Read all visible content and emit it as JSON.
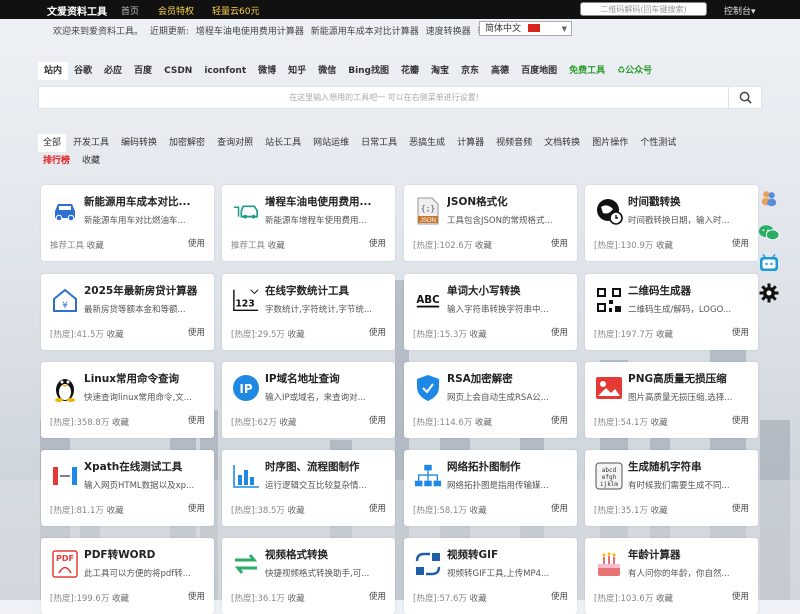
{
  "topbar": {
    "logo": "文爱资料工具",
    "nav": [
      "首页",
      "会员特权",
      "轻量云60元"
    ],
    "search_placeholder": "二维码解码(回车键搜索)",
    "console": "控制台▾"
  },
  "welcome": {
    "greeting": "欢迎来到爱资料工具。",
    "recent_label": "近期更新:",
    "recent": [
      "增程车油电使用费用计算器",
      "新能源用车成本对比计算器",
      "速度转换器",
      "等等"
    ],
    "language": "简体中文"
  },
  "engines": [
    "站内",
    "谷歌",
    "必应",
    "百度",
    "CSDN",
    "iconfont",
    "微博",
    "知乎",
    "微信",
    "Bing找图",
    "花瓣",
    "淘宝",
    "京东",
    "高德",
    "百度地图",
    "免费工具",
    "♻公众号"
  ],
  "search": {
    "placeholder": "在这里输入想用的工具吧一 可以在右侧菜单进行设置!"
  },
  "categories": [
    "全部",
    "开发工具",
    "编码转换",
    "加密解密",
    "查询对照",
    "站长工具",
    "网站运维",
    "日常工具",
    "恶搞生成",
    "计算器",
    "视频音频",
    "文档转换",
    "图片操作",
    "个性测试",
    "排行榜",
    "收藏"
  ],
  "cards": [
    {
      "title": "新能源用车成本对比...",
      "desc": "新能源车用车对比燃油车...",
      "meta": "推荐工具",
      "fav": "收藏",
      "use": "使用",
      "icon": "electric-car-icon"
    },
    {
      "title": "增程车油电使用费用...",
      "desc": "新能源车增程车使用费用...",
      "meta": "推荐工具",
      "fav": "收藏",
      "use": "使用",
      "icon": "charging-car-icon"
    },
    {
      "title": "JSON格式化",
      "desc": "工具包含JSON的常规格式...",
      "meta": "[热度]:102.6万",
      "fav": "收藏",
      "use": "使用",
      "icon": "json-file-icon"
    },
    {
      "title": "时间戳转换",
      "desc": "时间戳转换日期，输入时...",
      "meta": "[热度]:130.9万",
      "fav": "收藏",
      "use": "使用",
      "icon": "clock-globe-icon"
    },
    {
      "title": "2025年最新房贷计算器",
      "desc": "最新房贷等额本金和等额...",
      "meta": "[热度]:41.5万",
      "fav": "收藏",
      "use": "使用",
      "icon": "house-icon"
    },
    {
      "title": "在线字数统计工具",
      "desc": "字数统计,字符统计,字节统...",
      "meta": "[热度]:29.5万",
      "fav": "收藏",
      "use": "使用",
      "icon": "count-123-icon"
    },
    {
      "title": "单词大小写转换",
      "desc": "输入字符串转换字符串中...",
      "meta": "[热度]:15.3万",
      "fav": "收藏",
      "use": "使用",
      "icon": "abc-icon"
    },
    {
      "title": "二维码生成器",
      "desc": "二维码生成/解码，LOGO...",
      "meta": "[热度]:197.7万",
      "fav": "收藏",
      "use": "使用",
      "icon": "qrcode-icon"
    },
    {
      "title": "Linux常用命令查询",
      "desc": "快速查询linux常用命令,文...",
      "meta": "[热度]:358.8万",
      "fav": "收藏",
      "use": "使用",
      "icon": "linux-penguin-icon"
    },
    {
      "title": "IP域名地址查询",
      "desc": "输入IP或域名，来查询对...",
      "meta": "[热度]:62万",
      "fav": "收藏",
      "use": "使用",
      "icon": "ip-icon"
    },
    {
      "title": "RSA加密解密",
      "desc": "网页上会自动生成RSA公...",
      "meta": "[热度]:114.6万",
      "fav": "收藏",
      "use": "使用",
      "icon": "shield-icon"
    },
    {
      "title": "PNG高质量无损压缩",
      "desc": "图片高质量无损压缩,选择...",
      "meta": "[热度]:54.1万",
      "fav": "收藏",
      "use": "使用",
      "icon": "image-icon"
    },
    {
      "title": "Xpath在线测试工具",
      "desc": "输入网页HTML数据以及xp...",
      "meta": "[热度]:81.1万",
      "fav": "收藏",
      "use": "使用",
      "icon": "xpath-icon"
    },
    {
      "title": "时序图、流程图制作",
      "desc": "运行逻辑交互比较复杂情...",
      "meta": "[热度]:38.5万",
      "fav": "收藏",
      "use": "使用",
      "icon": "bar-chart-icon"
    },
    {
      "title": "网络拓扑图制作",
      "desc": "网络拓扑图是指用传输媒...",
      "meta": "[热度]:58.1万",
      "fav": "收藏",
      "use": "使用",
      "icon": "topology-icon"
    },
    {
      "title": "生成随机字符串",
      "desc": "有时候我们需要生成不同...",
      "meta": "[热度]:35.1万",
      "fav": "收藏",
      "use": "使用",
      "icon": "random-string-icon"
    },
    {
      "title": "PDF转WORD",
      "desc": "此工具可以方便的将pdf转...",
      "meta": "[热度]:199.6万",
      "fav": "收藏",
      "use": "使用",
      "icon": "pdf-icon"
    },
    {
      "title": "视频格式转换",
      "desc": "快捷视频格式转换助手,可...",
      "meta": "[热度]:36.1万",
      "fav": "收藏",
      "use": "使用",
      "icon": "convert-arrows-icon"
    },
    {
      "title": "视频转GIF",
      "desc": "视频转GIF工具,上传MP4...",
      "meta": "[热度]:57.6万",
      "fav": "收藏",
      "use": "使用",
      "icon": "video-gif-icon"
    },
    {
      "title": "年龄计算器",
      "desc": "有人问你的年龄，你自然...",
      "meta": "[热度]:103.6万",
      "fav": "收藏",
      "use": "使用",
      "icon": "birthday-cake-icon"
    }
  ],
  "side_icons": [
    "users-icon",
    "wechat-icon",
    "bilibili-icon",
    "gear-icon"
  ],
  "colors": {
    "accent": "#1a73c9",
    "topbar": "#111111",
    "hot_red": "#e02020",
    "green": "#2a9c2a"
  }
}
